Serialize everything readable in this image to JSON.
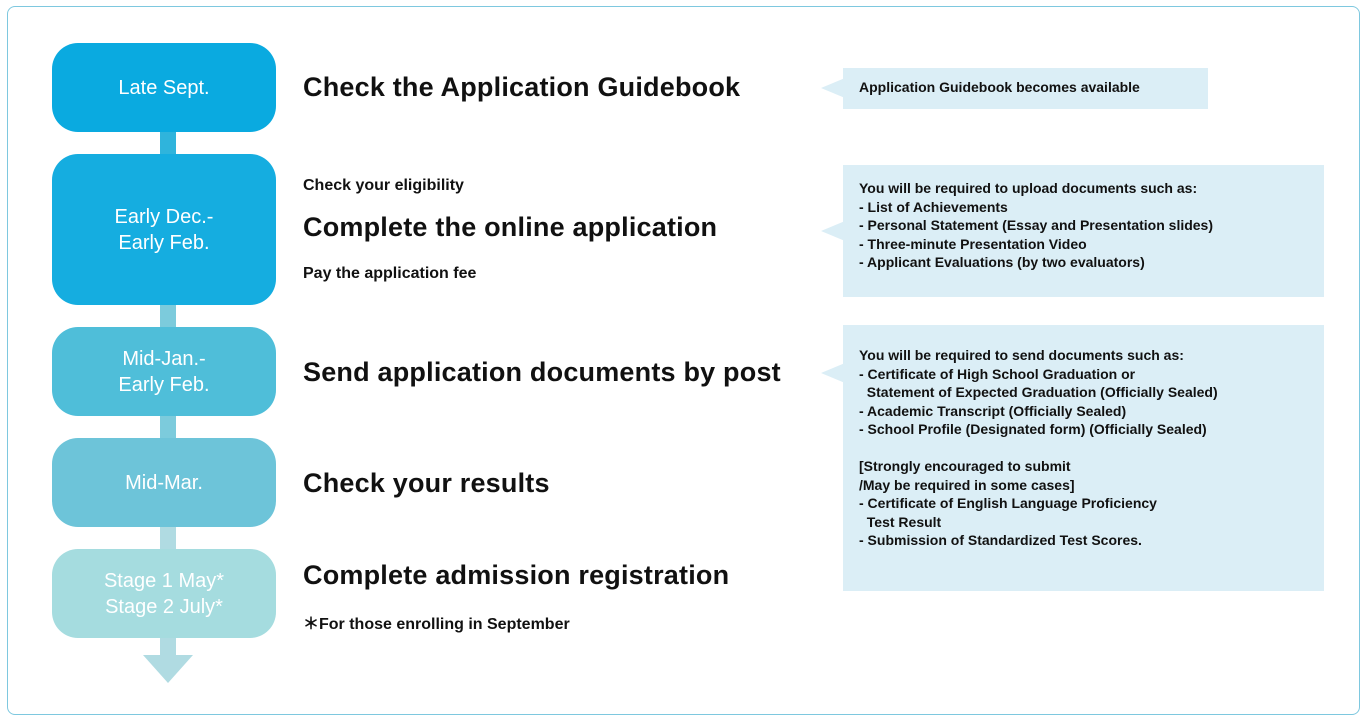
{
  "colors": {
    "frame": "#7ec8df",
    "note_bg": "#dbeef6",
    "timeline_stages": [
      "#0aaae0",
      "#15ade0",
      "#4fbed9",
      "#6dc4d9",
      "#a5dcdf"
    ]
  },
  "timeline": [
    {
      "label": "Late Sept."
    },
    {
      "label": "Early Dec.-\nEarly Feb."
    },
    {
      "label": "Mid-Jan.-\nEarly Feb."
    },
    {
      "label": "Mid-Mar."
    },
    {
      "label": "Stage 1 May*\nStage 2 July*"
    }
  ],
  "steps": {
    "guidebook": {
      "title": "Check the Application Guidebook"
    },
    "online": {
      "pre": "Check your eligibility",
      "title": "Complete the online application",
      "post": "Pay the application fee"
    },
    "post": {
      "title": "Send application documents by post"
    },
    "results": {
      "title": "Check your results"
    },
    "registration": {
      "title": "Complete admission registration",
      "note": "＊For those enrolling in September"
    }
  },
  "notes": {
    "guidebook": "Application Guidebook becomes available",
    "upload": [
      "You will be required to upload documents such as:",
      "- List of Achievements",
      "- Personal Statement (Essay and Presentation slides)",
      "- Three-minute Presentation Video",
      "- Applicant Evaluations (by two evaluators)"
    ],
    "send": [
      "You will be required to send documents such as:",
      "- Certificate of High School Graduation or",
      "  Statement of Expected Graduation (Officially Sealed)",
      "- Academic Transcript (Officially Sealed)",
      "- School Profile (Designated form) (Officially Sealed)",
      "",
      "[Strongly encouraged to submit",
      "/May be required in some cases]",
      "- Certificate of English Language Proficiency",
      "  Test Result",
      "- Submission of Standardized Test Scores."
    ]
  }
}
